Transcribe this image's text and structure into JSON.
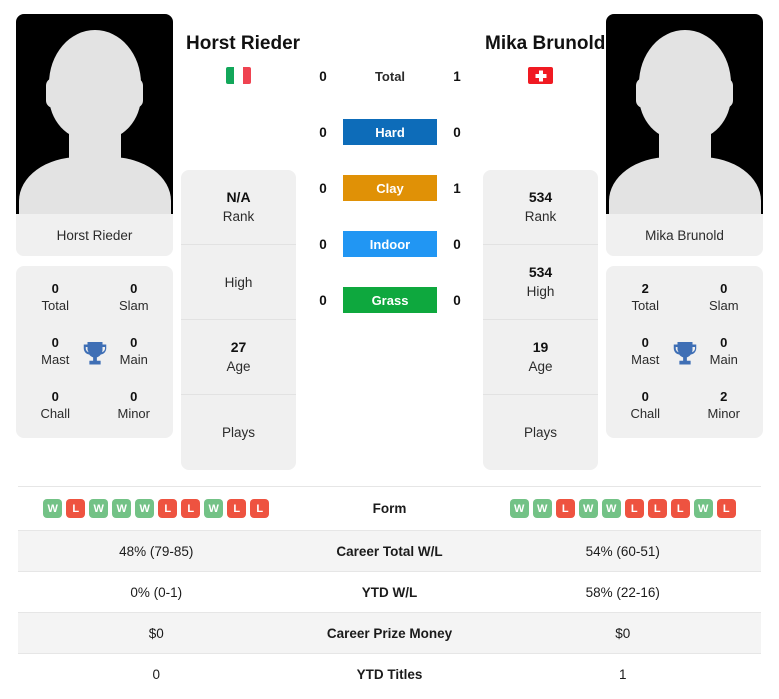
{
  "players": {
    "left": {
      "name": "Horst Rieder",
      "flag": "italy-flag",
      "avatar_name": "Horst Rieder",
      "titles": {
        "total_value": "0",
        "total_label": "Total",
        "slam_value": "0",
        "slam_label": "Slam",
        "mast_value": "0",
        "mast_label": "Mast",
        "main_value": "0",
        "main_label": "Main",
        "chall_value": "0",
        "chall_label": "Chall",
        "minor_value": "0",
        "minor_label": "Minor"
      },
      "info": {
        "rank_value": "N/A",
        "rank_label": "Rank",
        "high_value": "",
        "high_label": "High",
        "age_value": "27",
        "age_label": "Age",
        "plays_value": "",
        "plays_label": "Plays"
      },
      "surface_wins": {
        "total": "0",
        "hard": "0",
        "clay": "0",
        "indoor": "0",
        "grass": "0"
      },
      "form": [
        "W",
        "L",
        "W",
        "W",
        "W",
        "L",
        "L",
        "W",
        "L",
        "L"
      ],
      "career_total_wl": "48% (79-85)",
      "ytd_wl": "0% (0-1)",
      "career_prize_money": "$0",
      "ytd_titles": "0"
    },
    "right": {
      "name": "Mika Brunold",
      "flag": "switzerland-flag",
      "avatar_name": "Mika Brunold",
      "titles": {
        "total_value": "2",
        "total_label": "Total",
        "slam_value": "0",
        "slam_label": "Slam",
        "mast_value": "0",
        "mast_label": "Mast",
        "main_value": "0",
        "main_label": "Main",
        "chall_value": "0",
        "chall_label": "Chall",
        "minor_value": "2",
        "minor_label": "Minor"
      },
      "info": {
        "rank_value": "534",
        "rank_label": "Rank",
        "high_value": "534",
        "high_label": "High",
        "age_value": "19",
        "age_label": "Age",
        "plays_value": "",
        "plays_label": "Plays"
      },
      "surface_wins": {
        "total": "1",
        "hard": "0",
        "clay": "1",
        "indoor": "0",
        "grass": "0"
      },
      "form": [
        "W",
        "W",
        "L",
        "W",
        "W",
        "L",
        "L",
        "L",
        "W",
        "L"
      ],
      "career_total_wl": "54% (60-51)",
      "ytd_wl": "58% (22-16)",
      "career_prize_money": "$0",
      "ytd_titles": "1"
    }
  },
  "surfaces": [
    {
      "key": "total",
      "label": "Total",
      "color": "transparent"
    },
    {
      "key": "hard",
      "label": "Hard",
      "color": "#0d6cb9"
    },
    {
      "key": "clay",
      "label": "Clay",
      "color": "#e09106"
    },
    {
      "key": "indoor",
      "label": "Indoor",
      "color": "#2196f3"
    },
    {
      "key": "grass",
      "label": "Grass",
      "color": "#0ea83e"
    }
  ],
  "table_labels": {
    "form": "Form",
    "career_total_wl": "Career Total W/L",
    "ytd_wl": "YTD W/L",
    "career_prize_money": "Career Prize Money",
    "ytd_titles": "YTD Titles"
  },
  "colors": {
    "win": "#73c286",
    "loss": "#ee5340",
    "trophy": "#3f6fb5",
    "card_bg": "#f0f0f0"
  }
}
